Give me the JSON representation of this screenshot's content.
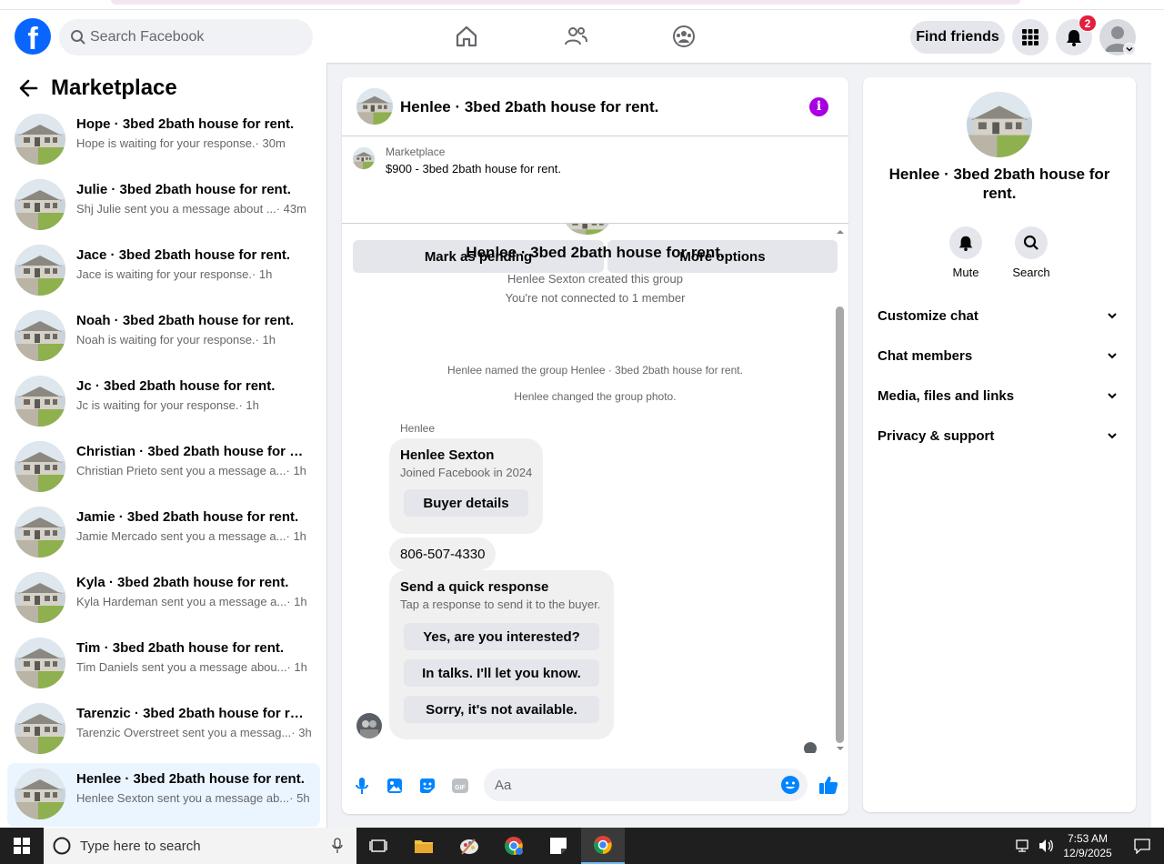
{
  "header": {
    "search_placeholder": "Search Facebook",
    "find_friends": "Find friends",
    "notification_count": "2",
    "brand_color": "#0866ff"
  },
  "sidebar": {
    "title": "Marketplace",
    "conversations": [
      {
        "name": "Hope · 3bed 2bath house for rent.",
        "snippet": "Hope is waiting for your response. ",
        "time": "· 30m"
      },
      {
        "name": "Julie · 3bed 2bath house for rent.",
        "snippet": "Shj Julie sent you a message about ...",
        "time": " · 43m"
      },
      {
        "name": "Jace · 3bed 2bath house for rent.",
        "snippet": "Jace is waiting for your response. ",
        "time": "· 1h"
      },
      {
        "name": "Noah · 3bed 2bath house for rent.",
        "snippet": "Noah is waiting for your response. ",
        "time": "· 1h"
      },
      {
        "name": "Jc · 3bed 2bath house for rent.",
        "snippet": "Jc is waiting for your response. ",
        "time": "· 1h"
      },
      {
        "name": "Christian · 3bed 2bath house for re...",
        "snippet": "Christian Prieto sent you a message a...",
        "time": " · 1h"
      },
      {
        "name": "Jamie · 3bed 2bath house for rent.",
        "snippet": "Jamie Mercado sent you a message a...",
        "time": " · 1h"
      },
      {
        "name": "Kyla · 3bed 2bath house for rent.",
        "snippet": "Kyla Hardeman sent you a message a...",
        "time": " · 1h"
      },
      {
        "name": "Tim · 3bed 2bath house for rent.",
        "snippet": "Tim Daniels sent you a message abou...",
        "time": " · 1h"
      },
      {
        "name": "Tarenzic · 3bed 2bath house for re...",
        "snippet": "Tarenzic Overstreet sent you a messag...",
        "time": " · 3h"
      },
      {
        "name": "Henlee · 3bed 2bath house for rent.",
        "snippet": "Henlee Sexton sent you a message ab...",
        "time": " · 5h"
      }
    ]
  },
  "chat": {
    "title": "Henlee · 3bed 2bath house for rent.",
    "listing": {
      "category": "Marketplace",
      "price_title": "$900 - 3bed 2bath house for rent.",
      "mark_pending": "Mark as pending",
      "more_options": "More options"
    },
    "group_title": "Henlee · 3bed 2bath house for rent.",
    "created_by": "Henlee Sexton created this group",
    "not_connected": "You're not connected to 1 member",
    "named_group": "Henlee named the group Henlee · 3bed 2bath house for rent.",
    "changed_photo": "Henlee changed the group photo.",
    "sender_label": "Henlee",
    "profile_card": {
      "name": "Henlee Sexton",
      "joined": "Joined Facebook in 2024",
      "button": "Buyer details"
    },
    "phone": "806-507-4330",
    "quick": {
      "title": "Send a quick response",
      "subtitle": "Tap a response to send it to the buyer.",
      "options": [
        "Yes, are you interested?",
        "In talks. I'll let you know.",
        "Sorry, it's not available."
      ]
    },
    "composer_placeholder": "Aa",
    "accent_color": "#0084ff",
    "info_color": "#a800e0"
  },
  "details": {
    "title": "Henlee · 3bed 2bath house for rent.",
    "mute": "Mute",
    "search": "Search",
    "sections": [
      "Customize chat",
      "Chat members",
      "Media, files and links",
      "Privacy & support"
    ]
  },
  "taskbar": {
    "search_placeholder": "Type here to search",
    "time": "7:53 AM",
    "date": "12/9/2025"
  }
}
